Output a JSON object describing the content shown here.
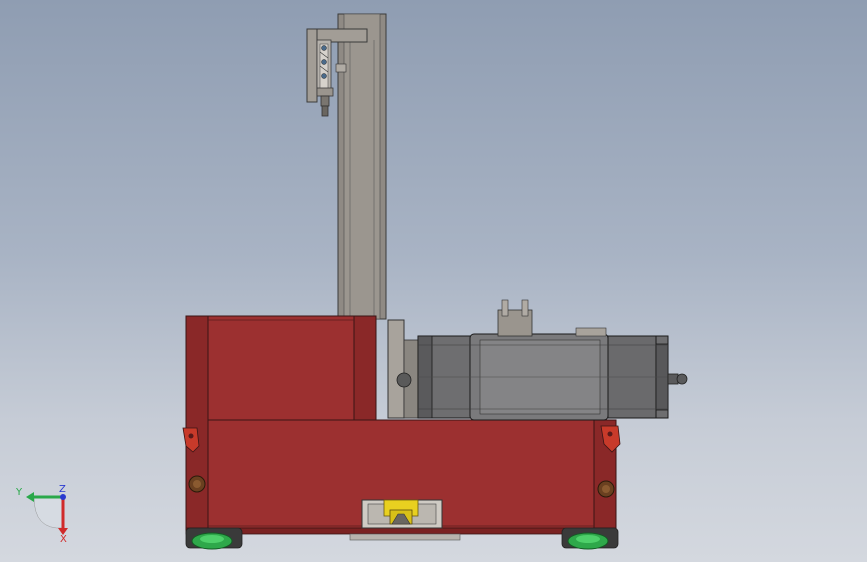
{
  "viewport": {
    "background_top": "#8f9db2",
    "background_bottom": "#d4d8df"
  },
  "colors": {
    "base_body": "#9c3030",
    "base_dark": "#7a2222",
    "column_gray": "#8f8a84",
    "motor_gray": "#6e6e70",
    "wheel_green": "#2ea84a",
    "latch_red": "#c83a2a",
    "limit_switch_yellow": "#e8d020"
  },
  "triad": {
    "y_label": "Y",
    "z_label": "Z",
    "x_label": "X",
    "y_color": "#2aa84a",
    "z_color": "#2a3ad0",
    "x_color": "#d02a2a"
  },
  "parts": [
    "vertical-column",
    "top-bracket",
    "red-base-body",
    "drive-motor",
    "front-wheel",
    "rear-wheel",
    "front-latch",
    "rear-latch",
    "limit-switch"
  ]
}
